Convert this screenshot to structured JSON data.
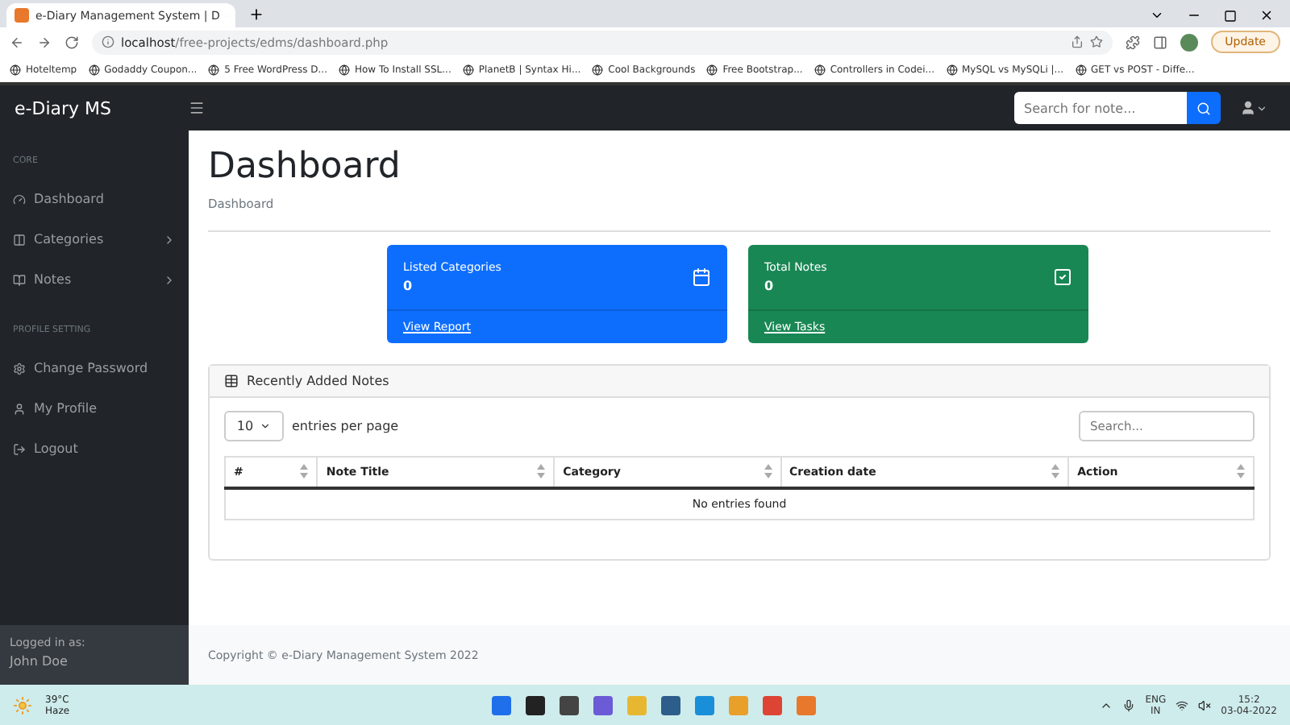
{
  "browser": {
    "tab_title": "e-Diary Management System | D",
    "url_host": "localhost",
    "url_path": "/free-projects/edms/dashboard.php",
    "update_label": "Update",
    "bookmarks": [
      "Hoteltemp",
      "Godaddy Coupon...",
      "5 Free WordPress D...",
      "How To Install SSL...",
      "PlanetB | Syntax Hi...",
      "Cool Backgrounds",
      "Free Bootstrap...",
      "Controllers in Codei...",
      "MySQL vs MySQLi |...",
      "GET vs POST - Diffe..."
    ]
  },
  "navbar": {
    "brand": "e-Diary MS",
    "search_placeholder": "Search for note..."
  },
  "sidebar": {
    "sections": [
      {
        "heading": "CORE",
        "items": [
          {
            "label": "Dashboard",
            "has_submenu": false
          },
          {
            "label": "Categories",
            "has_submenu": true
          },
          {
            "label": "Notes",
            "has_submenu": true
          }
        ]
      },
      {
        "heading": "PROFILE SETTING",
        "items": [
          {
            "label": "Change Password",
            "has_submenu": false
          },
          {
            "label": "My Profile",
            "has_submenu": false
          },
          {
            "label": "Logout",
            "has_submenu": false
          }
        ]
      }
    ],
    "footer": {
      "label": "Logged in as:",
      "user": "John Doe"
    }
  },
  "main": {
    "title": "Dashboard",
    "breadcrumb": "Dashboard",
    "cards": [
      {
        "title": "Listed Categories",
        "value": "0",
        "link": "View Report",
        "color": "#0d6efd"
      },
      {
        "title": "Total Notes",
        "value": "0",
        "link": "View Tasks",
        "color": "#198754"
      }
    ],
    "notes": {
      "title": "Recently Added Notes",
      "per_page": "10",
      "per_page_label": "entries per page",
      "search_placeholder": "Search...",
      "columns": [
        "#",
        "Note Title",
        "Category",
        "Creation date",
        "Action"
      ],
      "empty_message": "No entries found"
    },
    "footer": "Copyright © e-Diary Management System 2022"
  },
  "taskbar": {
    "temperature": "39°C",
    "weather": "Haze",
    "lang": "ENG",
    "region": "IN",
    "time": "15:2",
    "date": "03-04-2022"
  }
}
